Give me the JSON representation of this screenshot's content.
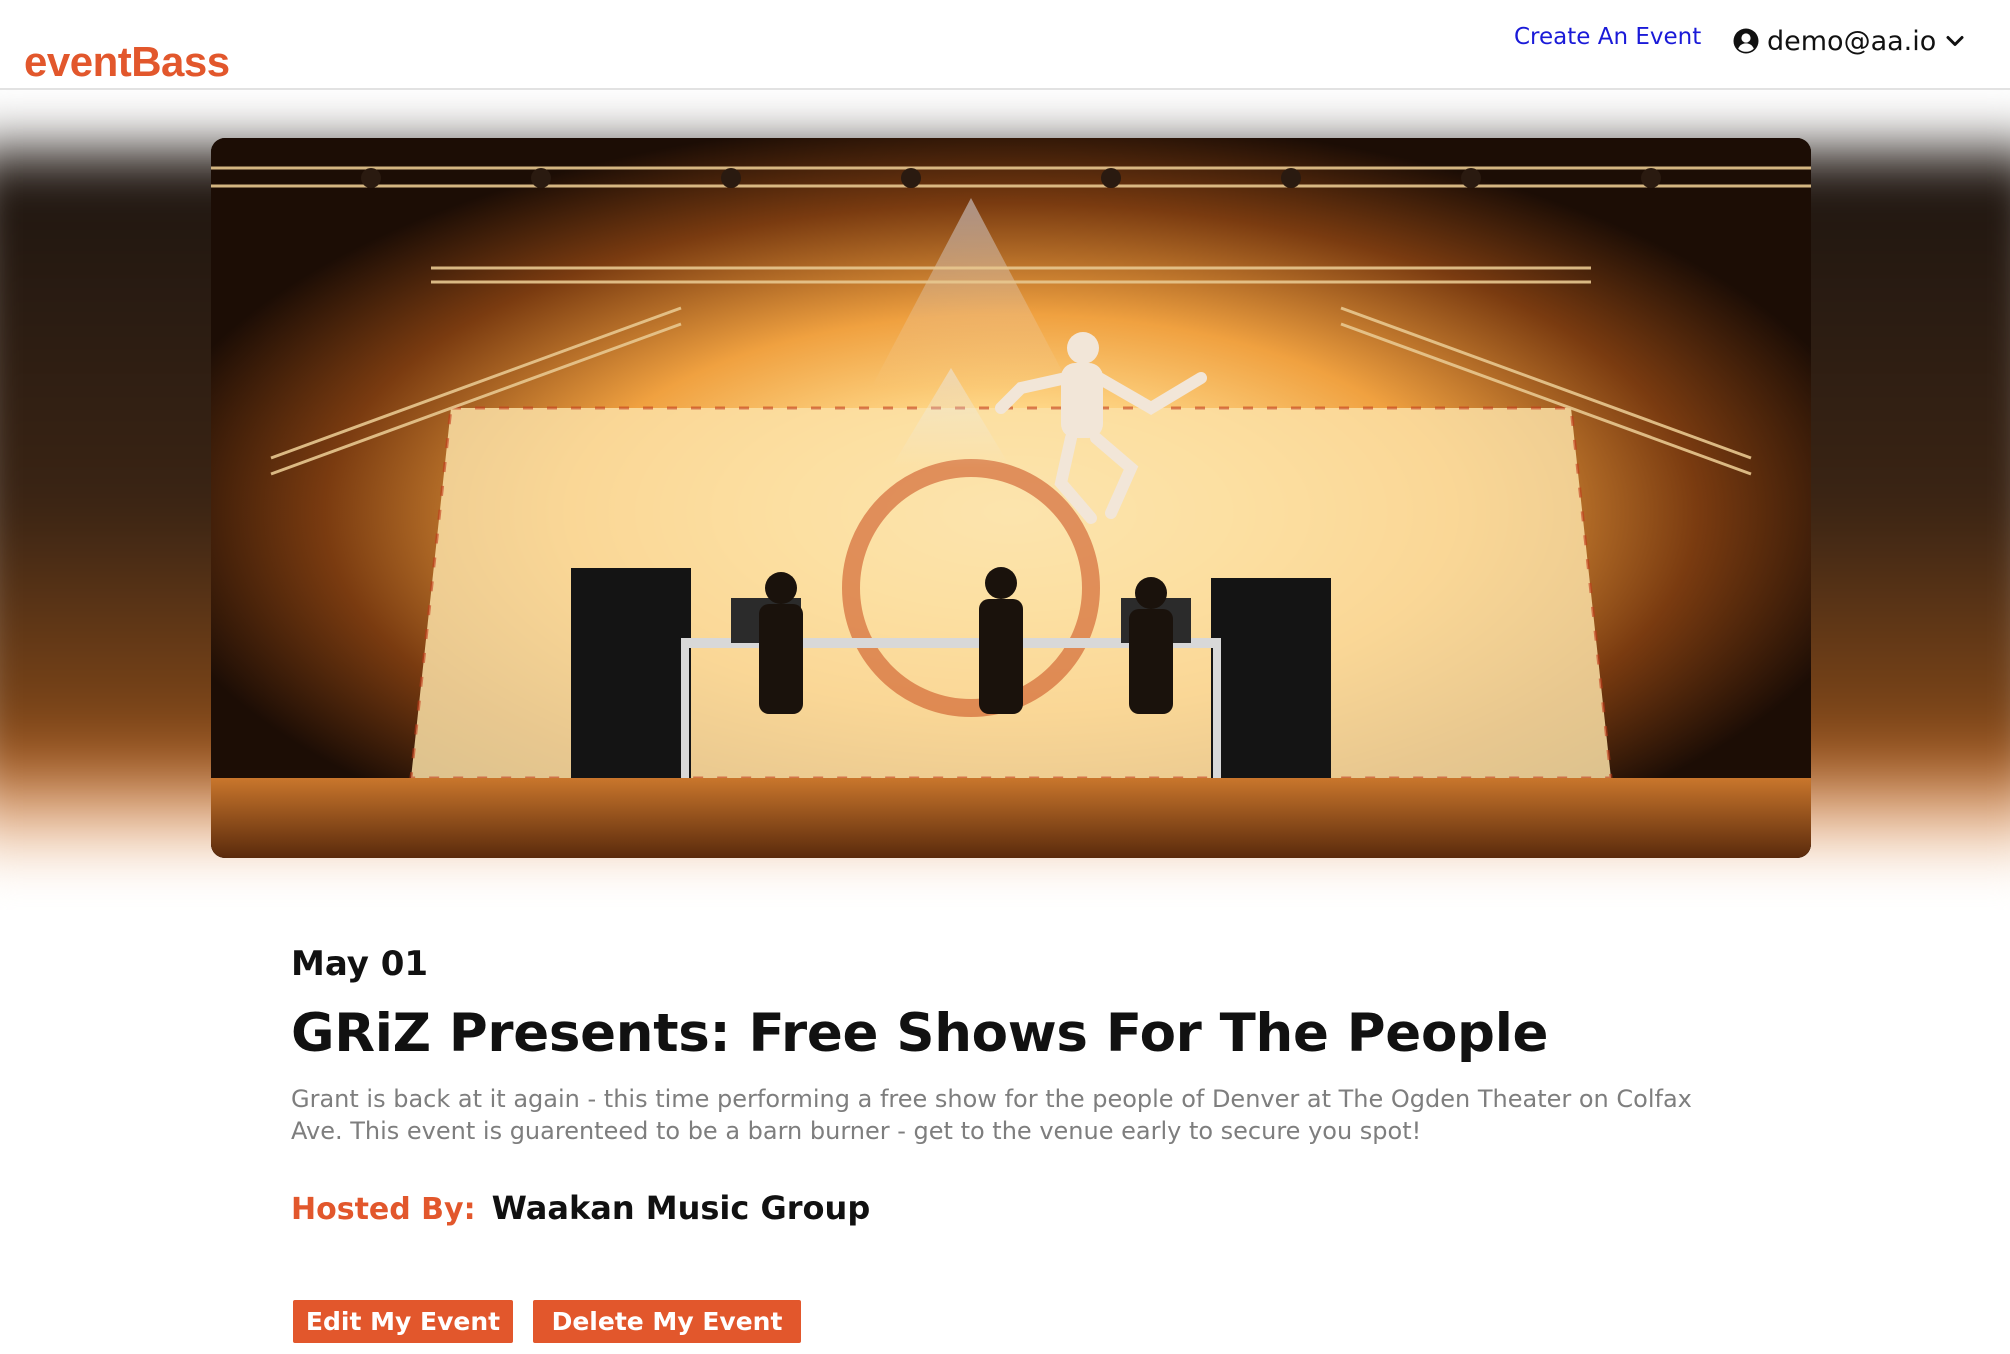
{
  "header": {
    "logo": "eventBass",
    "create_event_link": "Create An Event",
    "user_email": "demo@aa.io"
  },
  "event": {
    "date": "May 01",
    "title": "GRiZ Presents: Free Shows For The People",
    "description": "Grant is back at it again - this time performing a free show for the people of Denver at The Ogden Theater on Colfax Ave. This event is guarenteed to be a barn burner - get to the venue early to secure you spot!",
    "hosted_by_label": "Hosted By:",
    "host": "Waakan Music Group"
  },
  "actions": {
    "edit_label": "Edit My Event",
    "delete_label": "Delete My Event"
  },
  "colors": {
    "brand": "#e2572c",
    "link": "#1a1ad8",
    "text": "#111111",
    "muted": "#7e7e7e"
  },
  "icons": {
    "user": "user-circle-icon",
    "menu": "chevron-down-icon"
  }
}
